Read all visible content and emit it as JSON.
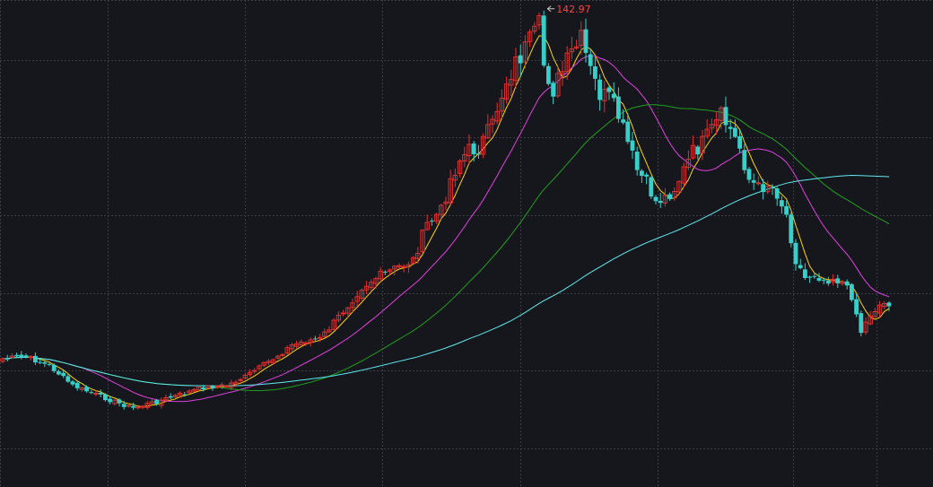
{
  "chart_data": {
    "type": "candlestick",
    "grid": true,
    "colors": {
      "background": "#16171c",
      "grid": "#3a3d45",
      "up": "#e0302e",
      "down": "#36cfc9",
      "annotation": "#ff4040"
    },
    "annotations": [
      {
        "text": "142.97",
        "type": "max_high_marker"
      }
    ],
    "series": [
      {
        "name": "",
        "role": "ma_fast",
        "color": "#ffd400"
      },
      {
        "name": "",
        "role": "ma_mid",
        "color": "#e040e0"
      },
      {
        "name": "",
        "role": "ma_slow",
        "color": "#1ea01e"
      },
      {
        "name": "",
        "role": "ma_long",
        "color": "#5fe8f0"
      }
    ]
  }
}
